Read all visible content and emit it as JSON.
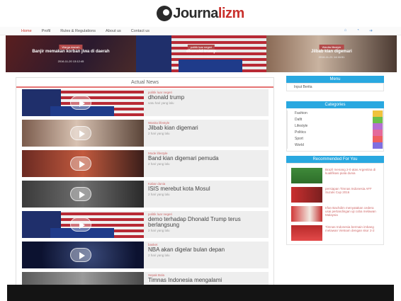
{
  "header": {
    "logo_prefix": "Journa",
    "logo_accent": "lizm"
  },
  "nav": {
    "items": [
      "Home",
      "Profil",
      "Rules & Regulations",
      "About us",
      "Contact us"
    ],
    "icons": [
      "facebook-icon",
      "twitter-icon",
      "rss-icon"
    ]
  },
  "slider": [
    {
      "tag": "Warga daerah",
      "headline": "Banjir memakan korban jiwa di daerah",
      "date": "2016-11-20 13:12:45",
      "colors": [
        "#5a1f1f",
        "#2b1a2e"
      ]
    },
    {
      "tag": "politik luar negeri",
      "headline": "dhonald trump",
      "date": "2016-11-21 7:32:42",
      "colors": [
        "#7a1d2a",
        "#1f2f6b"
      ]
    },
    {
      "tag": "Wanita lifestyle",
      "headline": "Jilbab kian digemari",
      "date": "2016-11-21 14:16:51",
      "colors": [
        "#8a6a55",
        "#4b3a32"
      ]
    }
  ],
  "main": {
    "title": "Actual News",
    "items": [
      {
        "category": "politik luar negeri",
        "title": "dhonald trump",
        "time": "satu hari yang lalu",
        "thumb": "trump"
      },
      {
        "category": "Wanita lifestyle",
        "title": "Jilbab kian digemari",
        "time": "2 hari yang lalu",
        "thumb": "hijab"
      },
      {
        "category": "Mode lifestyle",
        "title": "Band kian digemari pemuda",
        "time": "2 hari yang lalu",
        "thumb": "band"
      },
      {
        "category": "Kabar dunia",
        "title": "ISIS merebut kota Mosul",
        "time": "2 hari yang lalu",
        "thumb": "isis"
      },
      {
        "category": "politik luar negeri",
        "title": "demo terhadap Dhonald Trump terus berlangsung",
        "time": "2 hari yang lalu",
        "thumb": "trump"
      },
      {
        "category": "basket",
        "title": "NBA akan digelar bulan depan",
        "time": "2 hari yang lalu",
        "thumb": "nba"
      },
      {
        "category": "Sepak Bola",
        "title": "Timnas Indonesia mengalami",
        "time": "",
        "thumb": "timnas"
      }
    ]
  },
  "sidebar": {
    "menu_title": "Menu",
    "menu_item": "Input Berita",
    "categories_title": "Categories",
    "categories": [
      {
        "name": "Fashion",
        "color": "#f0c33c"
      },
      {
        "name": "Dafit",
        "color": "#6cc04a"
      },
      {
        "name": "Lifestyle",
        "color": "#b56fd3"
      },
      {
        "name": "Politics",
        "color": "#e46a9b"
      },
      {
        "name": "Sport",
        "color": "#ef5f5f"
      },
      {
        "name": "World",
        "color": "#7f6fe0"
      }
    ],
    "recommended_title": "Recommended For You",
    "recommended": [
      {
        "title": "Brazil menang 2-0 atas Argentina di kualifikasi piala dunia",
        "thumb": "brazil"
      },
      {
        "title": "persiapan Timnas Indonesia AFF Suzuki Cup 2016",
        "thumb": "timnas"
      },
      {
        "title": "Irfan Bachdim menyatakan cedera usai pertandingan uji coba melawan Malaysia",
        "thumb": "bachdim"
      },
      {
        "title": "Timnas Indonesia bermain imbang melawan Vietnam dengan skor 2-2",
        "thumb": "team"
      }
    ]
  }
}
